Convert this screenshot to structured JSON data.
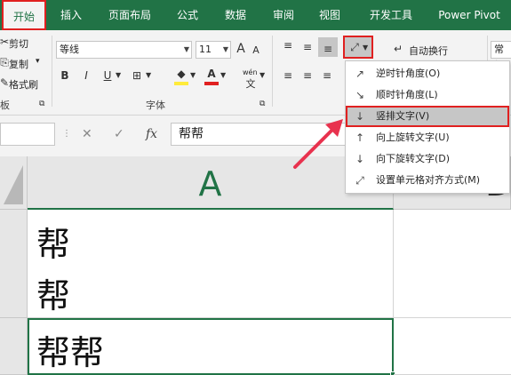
{
  "tabs": [
    {
      "label": "开始",
      "active": true
    },
    {
      "label": "插入"
    },
    {
      "label": "页面布局"
    },
    {
      "label": "公式"
    },
    {
      "label": "数据"
    },
    {
      "label": "审阅"
    },
    {
      "label": "视图"
    },
    {
      "label": "开发工具"
    },
    {
      "label": "Power Pivot"
    }
  ],
  "clipboard": {
    "cut": "剪切",
    "copy": "复制",
    "copy_caret": "▾",
    "format_painter": "格式刷",
    "group_label_fragment": "板"
  },
  "font": {
    "name": "等线",
    "size": "11",
    "grow": "A",
    "shrink": "A",
    "bold": "B",
    "italic": "I",
    "underline": "U",
    "phonetic": "wén",
    "group_label": "字体"
  },
  "alignment": {
    "wrap_text": "自动换行",
    "number_format_fragment": "常规"
  },
  "formula_bar": {
    "cancel": "✕",
    "enter": "✓",
    "fx": "fx",
    "content": "帮帮"
  },
  "grid": {
    "column_a": "A",
    "column_b_fragment": "D",
    "cells": [
      {
        "text": "帮"
      },
      {
        "text": "帮"
      },
      {
        "text": "帮帮"
      }
    ]
  },
  "orientation_menu": [
    {
      "label": "逆时针角度(O)",
      "icon": "counterclockwise-angle-icon"
    },
    {
      "label": "顺时针角度(L)",
      "icon": "clockwise-angle-icon"
    },
    {
      "label": "竖排文字(V)",
      "icon": "vertical-text-icon",
      "highlighted": true
    },
    {
      "label": "向上旋转文字(U)",
      "icon": "rotate-up-icon"
    },
    {
      "label": "向下旋转文字(D)",
      "icon": "rotate-down-icon"
    },
    {
      "label": "设置单元格对齐方式(M)",
      "icon": "format-alignment-icon"
    }
  ],
  "colors": {
    "accent": "#217346",
    "highlight_border": "#e02020",
    "arrow": "#e8324e"
  }
}
